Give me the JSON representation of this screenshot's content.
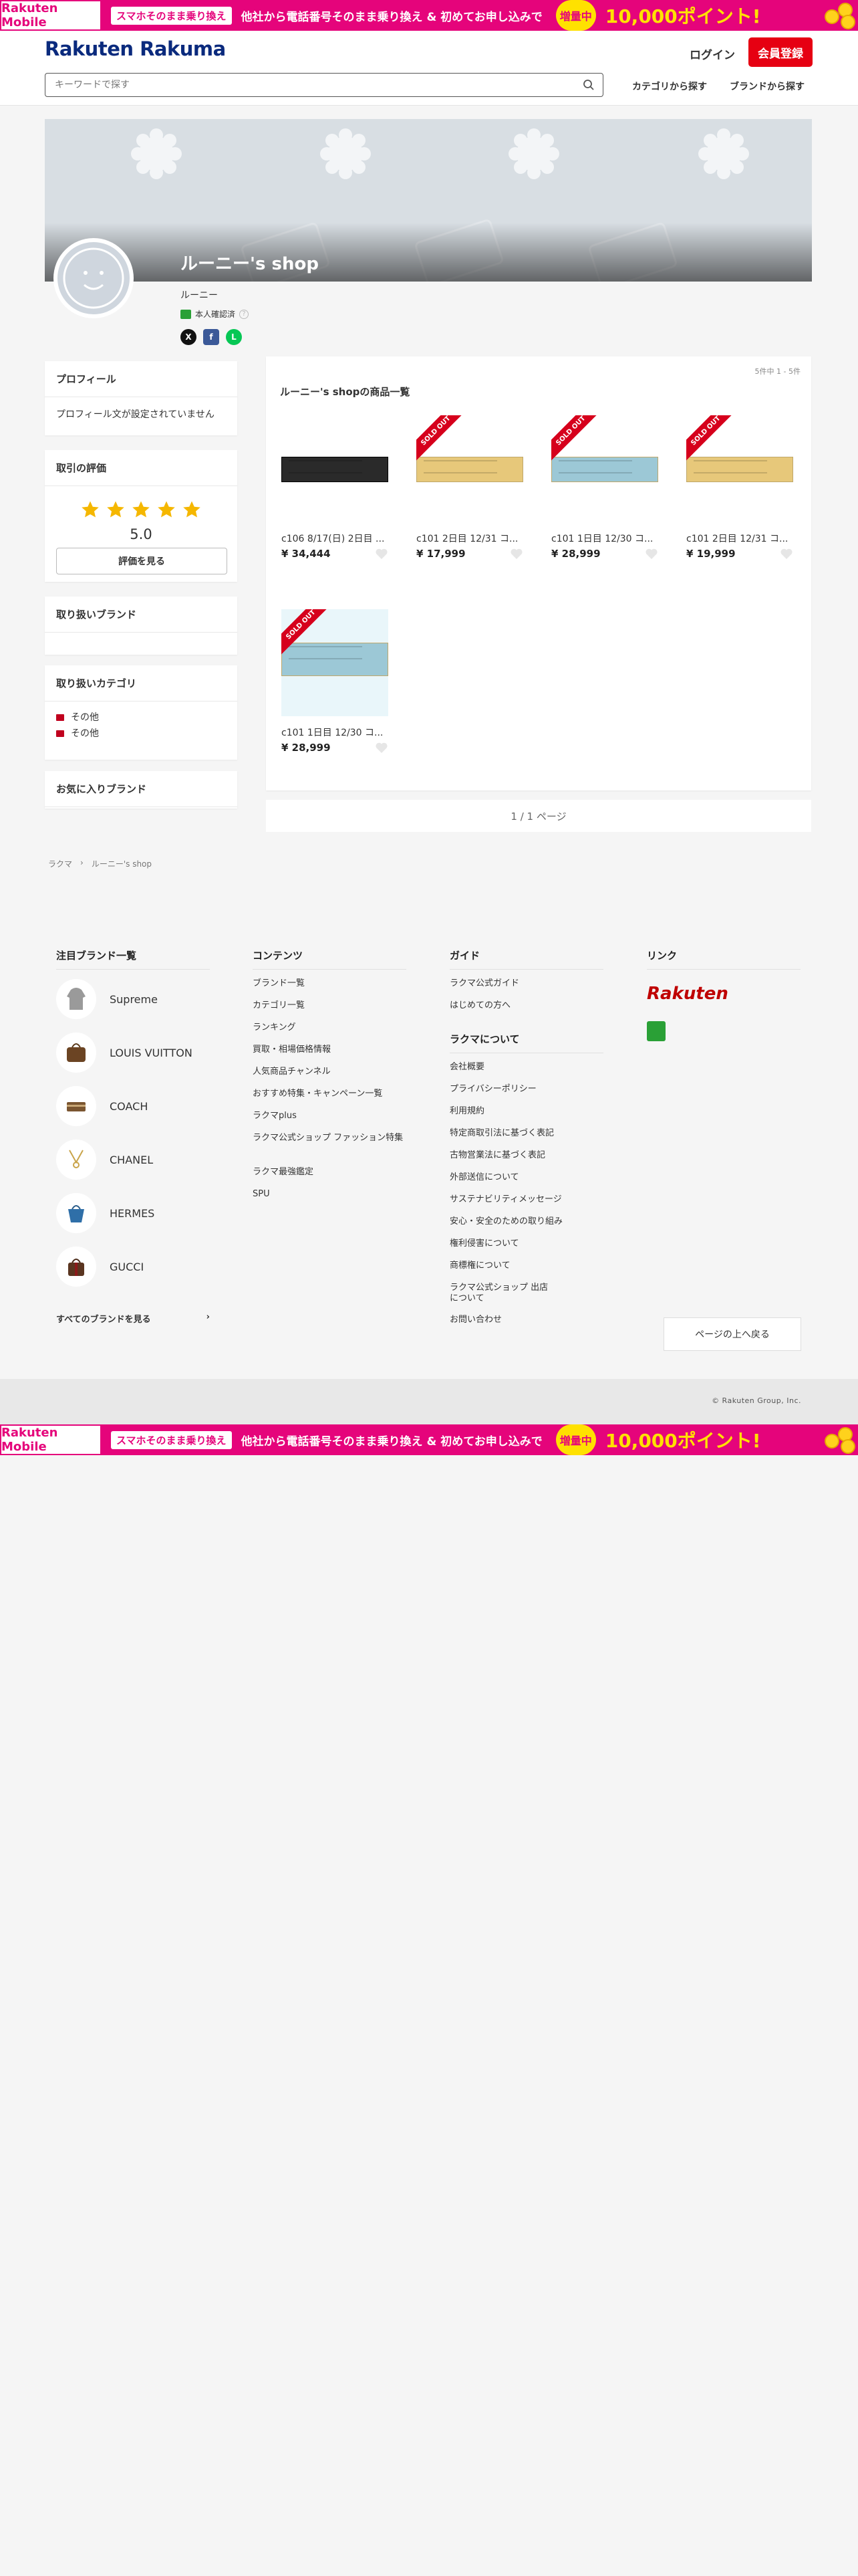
{
  "banner": {
    "brand": "Rakuten Mobile",
    "tag": "スマホそのまま乗り換え",
    "text": "他社から電話番号そのまま乗り換え & 初めてお申し込みで",
    "badge": "増量中",
    "points": "10,000ポイント!"
  },
  "header": {
    "logo": "Rakuten Rakuma",
    "login": "ログイン",
    "signup": "会員登録",
    "search_placeholder": "キーワードで探す",
    "nav_category": "カテゴリから探す",
    "nav_brand": "ブランドから探す"
  },
  "shop": {
    "title": "ルーニー's shop",
    "owner": "ルーニー",
    "verified": "本人確認済"
  },
  "sidebar": {
    "profile_head": "プロフィール",
    "profile_body": "プロフィール文が設定されていません",
    "rating_head": "取引の評価",
    "rating_stars": 5,
    "rating_value": "5.0",
    "rating_button": "評価を見る",
    "brands_head": "取り扱いブランド",
    "categories_head": "取り扱いカテゴリ",
    "categories": [
      "その他",
      "その他"
    ],
    "fav_head": "お気に入りブランド"
  },
  "products_panel": {
    "count": "5件中 1 - 5件",
    "title": "ルーニー's shopの商品一覧",
    "sold_label": "SOLD OUT",
    "items": [
      {
        "name": "c106 8/17(日) 2日目 ...",
        "price": "¥ 34,444",
        "sold": false
      },
      {
        "name": "c101 2日目 12/31 コ...",
        "price": "¥ 17,999",
        "sold": true
      },
      {
        "name": "c101 1日目 12/30 コ...",
        "price": "¥ 28,999",
        "sold": true
      },
      {
        "name": "c101 2日目 12/31 コ...",
        "price": "¥ 19,999",
        "sold": true
      },
      {
        "name": "c101 1日目 12/30 コ...",
        "price": "¥ 28,999",
        "sold": true
      }
    ]
  },
  "pager": "1 / 1 ページ",
  "breadcrumb": {
    "home": "ラクマ",
    "current": "ルーニー's shop"
  },
  "footer": {
    "brands_head": "注目ブランド一覧",
    "brands": [
      "Supreme",
      "LOUIS VUITTON",
      "COACH",
      "CHANEL",
      "HERMES",
      "GUCCI"
    ],
    "all_brands": "すべてのブランドを見る",
    "contents_head": "コンテンツ",
    "contents": [
      "ブランド一覧",
      "カテゴリ一覧",
      "ランキング",
      "買取・相場価格情報",
      "人気商品チャンネル",
      "おすすめ特集・キャンペーン一覧",
      "ラクマplus",
      "ラクマ公式ショップ ファッション特集",
      "ラクマ最強鑑定",
      "SPU"
    ],
    "guide_head": "ガイド",
    "guide": [
      "ラクマ公式ガイド",
      "はじめての方へ"
    ],
    "about_head": "ラクマについて",
    "about": [
      "会社概要",
      "プライバシーポリシー",
      "利用規約",
      "特定商取引法に基づく表記",
      "古物営業法に基づく表記",
      "外部送信について",
      "サステナビリティメッセージ",
      "安心・安全のための取り組み",
      "権利侵害について",
      "商標権について",
      "ラクマ公式ショップ 出店について",
      "お問い合わせ"
    ],
    "links_head": "リンク",
    "rakuten_logo": "Rakuten",
    "top_button": "ページの上へ戻る",
    "copyright": "© Rakuten Group, Inc."
  }
}
